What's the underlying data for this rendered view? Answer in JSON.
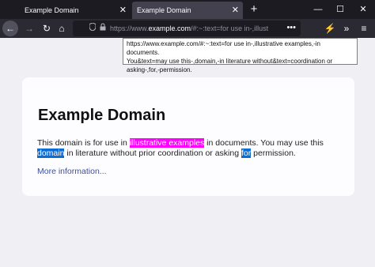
{
  "tabs": [
    {
      "label": "Example Domain",
      "close": "✕"
    },
    {
      "label": "Example Domain",
      "close": "✕"
    }
  ],
  "tabbar": {
    "new_tab": "+"
  },
  "window": {
    "minimize": "—",
    "maximize": "☐",
    "close": "✕"
  },
  "nav": {
    "back": "←",
    "forward": "→",
    "reload": "↻",
    "home": "⌂",
    "extensions": "⚡",
    "overflow": "»",
    "menu": "≡"
  },
  "urlbar": {
    "prefix": "https://www.",
    "domain": "example.com",
    "suffix": "/#:~:text=for use in-,illustrative",
    "more": "•••",
    "shield_icon": "shield-icon",
    "lock_icon": "lock-icon"
  },
  "tooltip": {
    "line1": "https://www.example.com/#:~:text=for use in-,illustrative examples,-in documents.",
    "line2": "You&text=may use this-,domain,-in literature without&text=coordination or",
    "line3": "asking-,for,-permission."
  },
  "page": {
    "title": "Example Domain",
    "p1_a": "This domain is for use in ",
    "p1_hl": "illustrative examples",
    "p1_b": " in documents. You may use this",
    "p2_hl1": "domain",
    "p2_a": " in literature without prior coordination or asking ",
    "p2_hl2": "for",
    "p2_b": " permission.",
    "link": "More information..."
  },
  "colors": {
    "highlight_magenta": "#ff00ff",
    "highlight_blue": "#0a6cd6",
    "chrome_dark": "#1c1b22",
    "link": "#3d4f9c"
  }
}
